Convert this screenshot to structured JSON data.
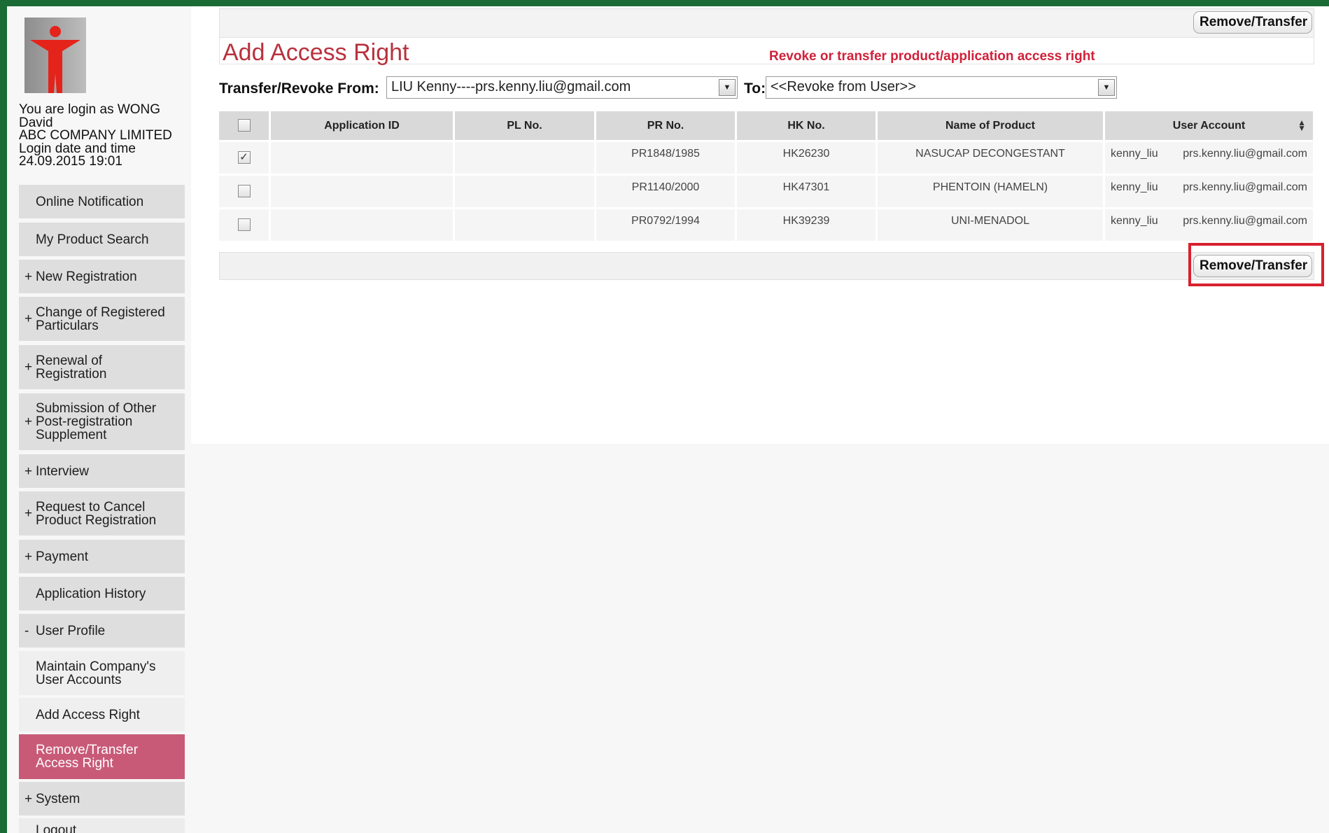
{
  "user": {
    "login_line": "You are login as WONG",
    "name_line": "David",
    "company": "ABC COMPANY LIMITED",
    "login_label": "Login date and time",
    "login_time": "24.09.2015 19:01"
  },
  "sidebar": {
    "items": [
      {
        "sign": "",
        "label": "Online Notification"
      },
      {
        "sign": "",
        "label": "My Product Search"
      },
      {
        "sign": "+",
        "label": "New Registration"
      },
      {
        "sign": "+",
        "label": "Change of Registered Particulars"
      },
      {
        "sign": "+",
        "label": "Renewal of Registration"
      },
      {
        "sign": "+",
        "label": "Submission of Other Post-registration Supplement"
      },
      {
        "sign": "+",
        "label": "Interview"
      },
      {
        "sign": "+",
        "label": "Request to Cancel Product Registration"
      },
      {
        "sign": "+",
        "label": "Payment"
      },
      {
        "sign": "",
        "label": "Application History"
      },
      {
        "sign": "-",
        "label": "User Profile"
      },
      {
        "sign": "",
        "label": "Maintain Company's User Accounts"
      },
      {
        "sign": "",
        "label": "Add Access Right"
      },
      {
        "sign": "",
        "label": "Remove/Transfer Access Right"
      },
      {
        "sign": "+",
        "label": "System"
      },
      {
        "sign": "",
        "label": "Logout"
      }
    ]
  },
  "toolbar": {
    "remove_transfer_label": "Remove/Transfer"
  },
  "page": {
    "title": "Add Access Right",
    "subtitle": "Revoke or transfer product/application access right"
  },
  "filters": {
    "from_label": "Transfer/Revoke From:",
    "from_value": "LIU Kenny----prs.kenny.liu@gmail.com",
    "to_label": "To:",
    "to_value": "<<Revoke from User>>"
  },
  "table": {
    "headers": [
      "Application ID",
      "PL No.",
      "PR No.",
      "HK No.",
      "Name of Product",
      "User Account"
    ],
    "rows": [
      {
        "checked": "✓",
        "app_id": "",
        "pl_no": "",
        "pr_no": "PR1848/1985",
        "hk_no": "HK26230",
        "product": "NASUCAP DECONGESTANT",
        "user": "kenny_liu",
        "email": "prs.kenny.liu@gmail.com"
      },
      {
        "checked": "",
        "app_id": "",
        "pl_no": "",
        "pr_no": "PR1140/2000",
        "hk_no": "HK47301",
        "product": "PHENTOIN (HAMELN)",
        "user": "kenny_liu",
        "email": "prs.kenny.liu@gmail.com"
      },
      {
        "checked": "",
        "app_id": "",
        "pl_no": "",
        "pr_no": "PR0792/1994",
        "hk_no": "HK39239",
        "product": "UNI-MENADOL",
        "user": "kenny_liu",
        "email": "prs.kenny.liu@gmail.com"
      }
    ]
  },
  "colors": {
    "frame": "#1a6b35",
    "title": "#b8313e",
    "subtitle": "#d0213a",
    "active_nav": "#c85a78",
    "highlight": "#d8202e"
  },
  "icons": {
    "logo": "red-figure-logo-icon",
    "dropdown": "chevron-down-icon",
    "sort": "sort-icon"
  }
}
